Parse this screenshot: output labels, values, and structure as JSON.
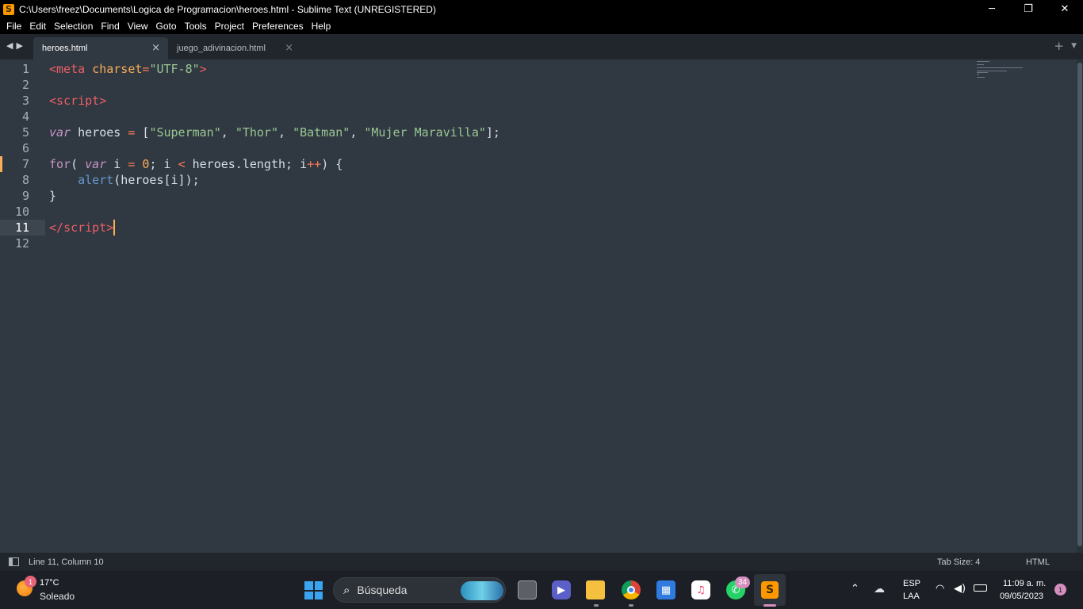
{
  "window": {
    "title": "C:\\Users\\freez\\Documents\\Logica de Programacion\\heroes.html - Sublime Text (UNREGISTERED)",
    "controls": {
      "minimize": "─",
      "restore": "❐",
      "close": "✕"
    },
    "app_icon": "S"
  },
  "menu": [
    "File",
    "Edit",
    "Selection",
    "Find",
    "View",
    "Goto",
    "Tools",
    "Project",
    "Preferences",
    "Help"
  ],
  "tabs": [
    {
      "label": "heroes.html",
      "active": true
    },
    {
      "label": "juego_adivinacion.html",
      "active": false
    }
  ],
  "tab_controls": {
    "nav": "◀▶",
    "close": "×",
    "new_tab": "+",
    "tab_list": "▼"
  },
  "editor": {
    "line_numbers": [
      "1",
      "2",
      "3",
      "4",
      "5",
      "6",
      "7",
      "8",
      "9",
      "10",
      "11",
      "12"
    ],
    "current_line": 11,
    "modified_line": 7,
    "code": {
      "l1": {
        "open": "<",
        "tag": "meta",
        "attr": "charset",
        "eq": "=",
        "val": "\"UTF-8\"",
        "close": ">"
      },
      "l3": {
        "open": "<",
        "tag": "script",
        "close": ">"
      },
      "l5": {
        "kw": "var",
        "name": " heroes ",
        "eq": "=",
        "open": " [",
        "s1": "\"Superman\"",
        "s2": "\"Thor\"",
        "s3": "\"Batman\"",
        "s4": "\"Mujer Maravilla\"",
        "comma": ", ",
        "close": "];"
      },
      "l7": {
        "for": "for",
        "p1": "( ",
        "var": "var",
        "i1": " i ",
        "eq": "=",
        "sp": " ",
        "zero": "0",
        "semi": "; i ",
        "lt": "<",
        "len": " heroes.length; i",
        "inc": "++",
        "end": ") {"
      },
      "l8": {
        "indent": "    ",
        "fn": "alert",
        "args": "(heroes[i]);"
      },
      "l9": {
        "brace": "}"
      },
      "l11": {
        "open": "</",
        "tag": "script",
        "close": ">"
      }
    }
  },
  "status": {
    "position": "Line 11, Column 10",
    "tab_size": "Tab Size: 4",
    "syntax": "HTML"
  },
  "taskbar": {
    "weather": {
      "temp": "17°C",
      "condition": "Soleado",
      "badge": "1"
    },
    "search_placeholder": "Búsqueda",
    "search_icon": "magnifier-icon",
    "whatsapp_badge": "34",
    "tray": {
      "language": "ESP",
      "layout": "LAA",
      "time": "11:09 a. m.",
      "date": "09/05/2023",
      "notifications": "1"
    }
  },
  "colors": {
    "editor_bg": "#303841",
    "tag": "#ec5f66",
    "string": "#99c794",
    "keyword": "#c695c6",
    "number": "#f9ae58",
    "function": "#6699cc"
  }
}
